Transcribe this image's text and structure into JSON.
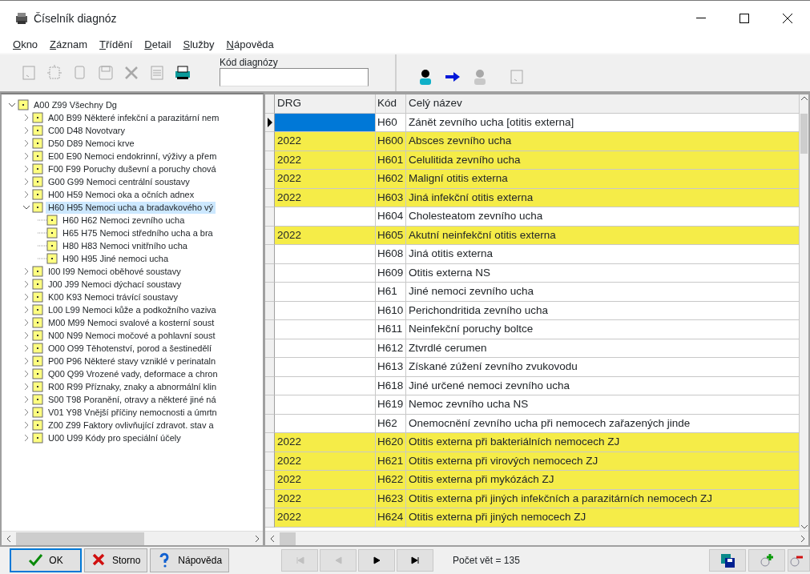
{
  "window": {
    "title": "Číselník diagnóz"
  },
  "menu": [
    "Okno",
    "Záznam",
    "Třídění",
    "Detail",
    "Služby",
    "Nápověda"
  ],
  "toolbar": [
    {
      "kind": "page",
      "disabled": true
    },
    {
      "kind": "new",
      "disabled": true
    },
    {
      "kind": "copy",
      "disabled": true
    },
    {
      "kind": "save",
      "disabled": true
    },
    {
      "kind": "delete",
      "disabled": true
    },
    {
      "kind": "sheet",
      "disabled": true
    },
    {
      "kind": "print",
      "disabled": false
    }
  ],
  "search": {
    "label": "Kód diagnózy"
  },
  "toolbar_right": [
    {
      "kind": "person",
      "disabled": false
    },
    {
      "kind": "arrow",
      "disabled": false
    },
    {
      "kind": "person",
      "disabled": true
    },
    {
      "kind": "page",
      "disabled": true
    }
  ],
  "tree": [
    {
      "label": "A00 Z99  Všechny Dg",
      "expanded": true,
      "selected": false,
      "children": [
        {
          "label": "A00 B99  Některé infekční a parazitární nem",
          "expanded": false,
          "selected": false
        },
        {
          "label": "C00 D48  Novotvary",
          "expanded": false,
          "selected": false
        },
        {
          "label": "D50 D89  Nemoci krve",
          "expanded": false,
          "selected": false
        },
        {
          "label": "E00 E90  Nemoci endokrinní, výživy a přem",
          "expanded": false,
          "selected": false
        },
        {
          "label": "F00 F99  Poruchy duševní a poruchy chová",
          "expanded": false,
          "selected": false
        },
        {
          "label": "G00 G99  Nemoci centrální soustavy",
          "expanded": false,
          "selected": false
        },
        {
          "label": "H00 H59  Nemoci oka a očních adnex",
          "expanded": false,
          "selected": false
        },
        {
          "label": "H60 H95  Nemoci ucha a bradavkového vý",
          "expanded": true,
          "selected": true,
          "children": [
            {
              "label": "H60 H62  Nemoci zevního ucha",
              "selected": false
            },
            {
              "label": "H65 H75  Nemoci středního ucha a bra",
              "selected": false
            },
            {
              "label": "H80 H83  Nemoci vnitřního ucha",
              "selected": false
            },
            {
              "label": "H90 H95  Jiné nemoci ucha",
              "selected": false
            }
          ]
        },
        {
          "label": "I00 I99  Nemoci oběhové soustavy",
          "expanded": false,
          "selected": false
        },
        {
          "label": "J00 J99  Nemoci dýchací soustavy",
          "expanded": false,
          "selected": false
        },
        {
          "label": "K00 K93  Nemoci trávící soustavy",
          "expanded": false,
          "selected": false
        },
        {
          "label": "L00 L99  Nemoci kůže a podkožního vaziva",
          "expanded": false,
          "selected": false
        },
        {
          "label": "M00 M99  Nemoci svalové a kosterní soust",
          "expanded": false,
          "selected": false
        },
        {
          "label": "N00 N99  Nemoci močové a pohlavní soust",
          "expanded": false,
          "selected": false
        },
        {
          "label": "O00 O99  Těhotenství, porod a šestinedělí",
          "expanded": false,
          "selected": false
        },
        {
          "label": "P00 P96  Některé stavy vzniklé v perinataln",
          "expanded": false,
          "selected": false
        },
        {
          "label": "Q00 Q99  Vrozené vady, deformace a chron",
          "expanded": false,
          "selected": false
        },
        {
          "label": "R00 R99  Příznaky, znaky a abnormální klin",
          "expanded": false,
          "selected": false
        },
        {
          "label": "S00 T98  Poranění, otravy a některé jiné ná",
          "expanded": false,
          "selected": false
        },
        {
          "label": "V01 Y98  Vnější příčiny nemocnosti a úmrtn",
          "expanded": false,
          "selected": false
        },
        {
          "label": "Z00 Z99  Faktory ovlivňující zdravot. stav a",
          "expanded": false,
          "selected": false
        },
        {
          "label": "U00 U99 Kódy pro speciální účely",
          "expanded": false,
          "selected": false
        }
      ]
    }
  ],
  "grid": {
    "columns": [
      "DRG",
      "Kód",
      "Celý název"
    ],
    "rows": [
      {
        "code": "H60",
        "name": "Zánět zevního ucha [otitis externa]",
        "highlighted": false,
        "selected": true
      },
      {
        "drg": "2022",
        "code": "H600",
        "name": "Absces zevního ucha",
        "highlighted": true,
        "selected": false
      },
      {
        "drg": "2022",
        "code": "H601",
        "name": "Celulitida zevního ucha",
        "highlighted": true,
        "selected": false
      },
      {
        "drg": "2022",
        "code": "H602",
        "name": "Maligní otitis externa",
        "highlighted": true,
        "selected": false
      },
      {
        "drg": "2022",
        "code": "H603",
        "name": "Jiná infekční otitis externa",
        "highlighted": true,
        "selected": false
      },
      {
        "code": "H604",
        "name": "Cholesteatom zevního ucha",
        "highlighted": false,
        "selected": false
      },
      {
        "drg": "2022",
        "code": "H605",
        "name": "Akutní neinfekční otitis externa",
        "highlighted": true,
        "selected": false
      },
      {
        "code": "H608",
        "name": "Jiná otitis externa",
        "highlighted": false,
        "selected": false
      },
      {
        "code": "H609",
        "name": "Otitis externa NS",
        "highlighted": false,
        "selected": false
      },
      {
        "code": "H61",
        "name": "Jiné nemoci zevního ucha",
        "highlighted": false,
        "selected": false
      },
      {
        "code": "H610",
        "name": "Perichondritida zevního ucha",
        "highlighted": false,
        "selected": false
      },
      {
        "code": "H611",
        "name": "Neinfekční poruchy boltce",
        "highlighted": false,
        "selected": false
      },
      {
        "code": "H612",
        "name": "Ztvrdlé cerumen",
        "highlighted": false,
        "selected": false
      },
      {
        "code": "H613",
        "name": "Získané zúžení zevního zvukovodu",
        "highlighted": false,
        "selected": false
      },
      {
        "code": "H618",
        "name": "Jiné určené nemoci zevního ucha",
        "highlighted": false,
        "selected": false
      },
      {
        "code": "H619",
        "name": "Nemoc zevního ucha NS",
        "highlighted": false,
        "selected": false
      },
      {
        "code": "H62",
        "name": "Onemocnění zevního ucha při nemocech zařazených jinde",
        "highlighted": false,
        "selected": false
      },
      {
        "drg": "2022",
        "code": "H620",
        "name": "Otitis externa při bakteriálních nemocech ZJ",
        "highlighted": true,
        "selected": false
      },
      {
        "drg": "2022",
        "code": "H621",
        "name": "Otitis externa při virových nemocech ZJ",
        "highlighted": true,
        "selected": false
      },
      {
        "drg": "2022",
        "code": "H622",
        "name": "Otitis externa při mykózách ZJ",
        "highlighted": true,
        "selected": false
      },
      {
        "drg": "2022",
        "code": "H623",
        "name": "Otitis externa při jiných infekčních a parazitárních nemocech ZJ",
        "highlighted": true,
        "selected": false
      },
      {
        "drg": "2022",
        "code": "H624",
        "name": "Otitis externa při jiných nemocech ZJ",
        "highlighted": true,
        "selected": false
      }
    ]
  },
  "buttons": [
    {
      "kind": "ok",
      "label": "OK",
      "focused": true
    },
    {
      "kind": "cancel",
      "label": "Storno",
      "focused": false
    },
    {
      "kind": "help",
      "label": "Nápověda",
      "focused": false
    }
  ],
  "navigator": [
    {
      "kind": "first",
      "disabled": true
    },
    {
      "kind": "prev",
      "disabled": true
    },
    {
      "kind": "next",
      "disabled": false
    },
    {
      "kind": "last",
      "disabled": false
    }
  ],
  "status": "Počet vět = 135",
  "tools": [
    {
      "kind": "save"
    },
    {
      "kind": "zoom-in"
    },
    {
      "kind": "zoom-out"
    }
  ]
}
